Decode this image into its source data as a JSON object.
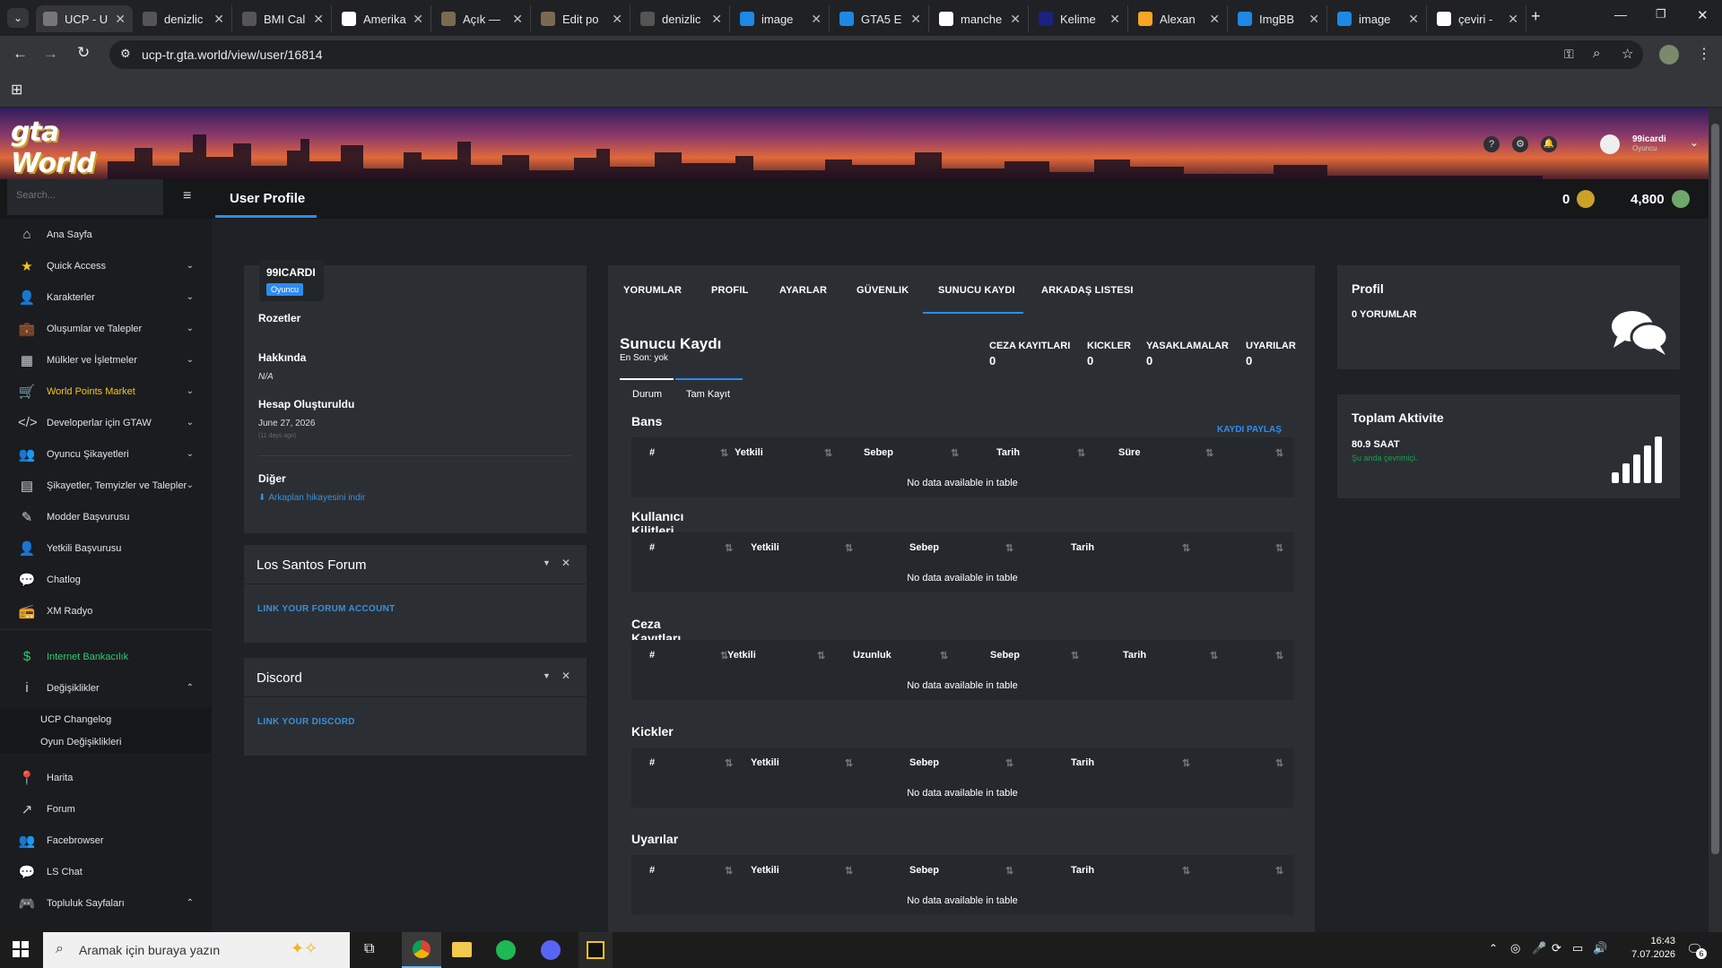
{
  "browser": {
    "tabs": [
      {
        "title": "UCP - U",
        "color": "#777",
        "active": true
      },
      {
        "title": "denizlic",
        "color": "#555"
      },
      {
        "title": "BMI Cal",
        "color": "#555"
      },
      {
        "title": "Amerika",
        "color": "#ffffff"
      },
      {
        "title": "Açık —",
        "color": "#7a6a50"
      },
      {
        "title": "Edit po",
        "color": "#7a6a50"
      },
      {
        "title": "denizlic",
        "color": "#555"
      },
      {
        "title": "image",
        "color": "#1e88e5"
      },
      {
        "title": "GTA5 E",
        "color": "#1e88e5"
      },
      {
        "title": "manche",
        "color": "#ffffff"
      },
      {
        "title": "Kelime",
        "color": "#1a237e"
      },
      {
        "title": "Alexan",
        "color": "#f5a623"
      },
      {
        "title": "ImgBB",
        "color": "#1e88e5"
      },
      {
        "title": "image",
        "color": "#1e88e5"
      },
      {
        "title": "çeviri -",
        "color": "#ffffff"
      }
    ],
    "url": "ucp-tr.gta.world/view/user/16814"
  },
  "header": {
    "logo": "gta World",
    "user_name": "99icardi",
    "user_role": "Oyuncu"
  },
  "topbar": {
    "search_placeholder": "Search...",
    "page_title": "User Profile",
    "coins": "0",
    "points": "4,800"
  },
  "sidebar": {
    "items": [
      {
        "label": "Ana Sayfa",
        "icon": "home-icon",
        "glyph": "⌂",
        "chev": "",
        "color": "#dfe3e8"
      },
      {
        "label": "Quick Access",
        "icon": "star-icon",
        "glyph": "★",
        "chev": "⌄",
        "color": "#dfe3e8",
        "iconcolor": "#f5c518"
      },
      {
        "label": "Karakterler",
        "icon": "user-icon",
        "glyph": "👤",
        "chev": "⌄",
        "color": "#dfe3e8"
      },
      {
        "label": "Oluşumlar ve Talepler",
        "icon": "briefcase-icon",
        "glyph": "💼",
        "chev": "⌄",
        "color": "#dfe3e8"
      },
      {
        "label": "Mülkler ve İşletmeler",
        "icon": "building-icon",
        "glyph": "▦",
        "chev": "⌄",
        "color": "#dfe3e8"
      },
      {
        "label": "World Points Market",
        "icon": "cart-icon",
        "glyph": "🛒",
        "chev": "⌄",
        "color": "#f5c518",
        "iconcolor": "#f5c518"
      },
      {
        "label": "Developerlar için GTAW",
        "icon": "code-icon",
        "glyph": "</>",
        "chev": "⌄",
        "color": "#dfe3e8"
      },
      {
        "label": "Oyuncu Şikayetleri",
        "icon": "user-flag-icon",
        "glyph": "👥",
        "chev": "⌄",
        "color": "#dfe3e8"
      },
      {
        "label": "Şikayetler, Temyizler ve Talepler",
        "icon": "clipboard-icon",
        "glyph": "▤",
        "chev": "⌄",
        "color": "#dfe3e8"
      },
      {
        "label": "Modder Başvurusu",
        "icon": "edit-icon",
        "glyph": "✎",
        "chev": "",
        "color": "#dfe3e8"
      },
      {
        "label": "Yetkili Başvurusu",
        "icon": "user-tie-icon",
        "glyph": "👤",
        "chev": "",
        "color": "#dfe3e8"
      },
      {
        "label": "Chatlog",
        "icon": "chat-icon",
        "glyph": "💬",
        "chev": "",
        "color": "#dfe3e8"
      },
      {
        "label": "XM Radyo",
        "icon": "radio-icon",
        "glyph": "📻",
        "chev": "",
        "color": "#dfe3e8"
      },
      {
        "label": "Internet Bankacılık",
        "icon": "dollar-icon",
        "glyph": "$",
        "chev": "",
        "color": "#2ecc71",
        "iconcolor": "#2ecc71"
      },
      {
        "label": "Değişiklikler",
        "icon": "info-icon",
        "glyph": "i",
        "chev": "⌃",
        "color": "#dfe3e8"
      },
      {
        "label": "UCP Changelog",
        "icon": "",
        "glyph": "",
        "chev": "",
        "color": "#dfe3e8",
        "sub": true
      },
      {
        "label": "Oyun Değişiklikleri",
        "icon": "",
        "glyph": "",
        "chev": "",
        "color": "#dfe3e8",
        "sub": true
      },
      {
        "label": "Harita",
        "icon": "map-pin-icon",
        "glyph": "📍",
        "chev": "",
        "color": "#dfe3e8"
      },
      {
        "label": "Forum",
        "icon": "external-link-icon",
        "glyph": "↗",
        "chev": "",
        "color": "#dfe3e8"
      },
      {
        "label": "Facebrowser",
        "icon": "users-icon",
        "glyph": "👥",
        "chev": "",
        "color": "#dfe3e8"
      },
      {
        "label": "LS Chat",
        "icon": "chat-bubbles-icon",
        "glyph": "💬",
        "chev": "",
        "color": "#dfe3e8"
      },
      {
        "label": "Topluluk Sayfaları",
        "icon": "discord-icon",
        "glyph": "🎮",
        "chev": "⌃",
        "color": "#dfe3e8"
      }
    ]
  },
  "profile": {
    "username": "99ICARDI",
    "role": "Oyuncu",
    "badges_label": "Rozetler",
    "about_label": "Hakkında",
    "about_value": "N/A",
    "created_label": "Hesap Oluşturuldu",
    "created_value": "June 27, 2026",
    "created_ago": "(11 days ago)",
    "other_label": "Diğer",
    "download_link": "Arkaplan hikayesini indir"
  },
  "forum_card": {
    "title": "Los Santos Forum",
    "link": "LINK YOUR FORUM ACCOUNT"
  },
  "discord_card": {
    "title": "Discord",
    "link": "LINK YOUR DISCORD"
  },
  "main": {
    "tabs": [
      "YORUMLAR",
      "PROFIL",
      "AYARLAR",
      "GÜVENLIK",
      "SUNUCU KAYDI",
      "ARKADAŞ LISTESI"
    ],
    "active_tab": "SUNUCU KAYDI",
    "title": "Sunucu Kaydı",
    "subtitle": "En Son: yok",
    "stats": [
      {
        "label": "CEZA KAYITLARI",
        "value": "0"
      },
      {
        "label": "KICKLER",
        "value": "0"
      },
      {
        "label": "YASAKLAMALAR",
        "value": "0"
      },
      {
        "label": "UYARILAR",
        "value": "0"
      }
    ],
    "subtabs": [
      "Durum",
      "Tam Kayıt"
    ],
    "share_label": "KAYDI PAYLAŞ",
    "no_data": "No data available in table",
    "sections": [
      {
        "title": "Bans",
        "cols": [
          "#",
          "Yetkili",
          "Sebep",
          "Tarih",
          "Süre"
        ]
      },
      {
        "title": "Kullanıcı Kilitleri",
        "cols": [
          "#",
          "Yetkili",
          "Sebep",
          "Tarih"
        ]
      },
      {
        "title": "Ceza Kayıtları",
        "cols": [
          "#",
          "Yetkili",
          "Uzunluk",
          "Sebep",
          "Tarih"
        ]
      },
      {
        "title": "Kickler",
        "cols": [
          "#",
          "Yetkili",
          "Sebep",
          "Tarih"
        ]
      },
      {
        "title": "Uyarılar",
        "cols": [
          "#",
          "Yetkili",
          "Sebep",
          "Tarih"
        ]
      }
    ]
  },
  "right": {
    "profile_title": "Profil",
    "comments": "0 YORUMLAR",
    "activity_title": "Toplam Aktivite",
    "hours": "80.9 SAAT",
    "status": "Şu anda çevrimiçi."
  },
  "taskbar": {
    "search_placeholder": "Aramak için buraya yazın",
    "time": "16:43",
    "date": "7.07.2026",
    "notif_count": "6"
  }
}
